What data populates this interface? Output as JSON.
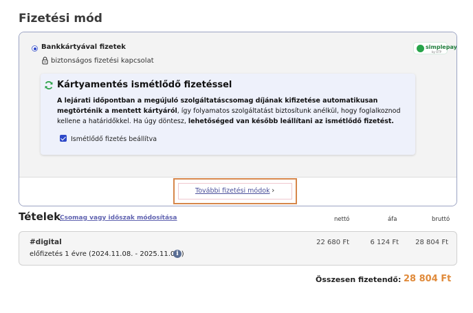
{
  "page": {
    "title": "Fizetési mód"
  },
  "payment": {
    "method_label": "Bankkártyával fizetek",
    "secure_text": "biztonságos fizetési kapcsolat",
    "provider_logo": {
      "name": "simplepay",
      "sub": "by OTP"
    },
    "recurring": {
      "title": "Kártyamentés ismétlődő fizetéssel",
      "text_part1": "A lejárati időpontban a megújuló szolgáltatáscsomag díjának kifizetése automatikusan megtörténik a mentett kártyáról",
      "text_part2": ", így folyamatos szolgáltatást biztosítunk anélkül, hogy foglalkoznod kellene a határidőkkel. Ha úgy döntesz, ",
      "text_part3": "lehetőséged van később leállítani az ismétlődő fizetést.",
      "checkbox_label": "Ismétlődő fizetés beállítva",
      "checkbox_checked": true
    },
    "more_methods_label": "További fizetési módok",
    "more_chevron": "›"
  },
  "items": {
    "title": "Tételek",
    "edit_link": "Csomag vagy időszak módosítása",
    "columns": {
      "net": "nettó",
      "vat": "áfa",
      "gross": "bruttó"
    },
    "rows": [
      {
        "name": "#digital",
        "desc": "előfizetés 1 évre (2024.11.08. - 2025.11.07.)",
        "net": "22 680 Ft",
        "vat": "6 124 Ft",
        "gross": "28 804 Ft"
      }
    ]
  },
  "total": {
    "label": "Összesen fizetendő:",
    "value": "28 804 Ft"
  },
  "colors": {
    "accent": "#2c44c9",
    "highlight_border": "#d6864a",
    "total": "#e08a3a",
    "green": "#27a54a"
  }
}
